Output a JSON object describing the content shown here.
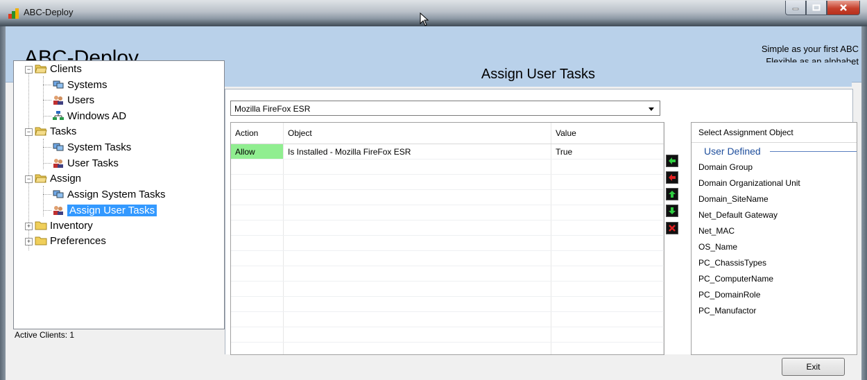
{
  "window": {
    "title": "ABC-Deploy"
  },
  "header": {
    "app_title": "ABC-Deploy",
    "tagline_line1": "Simple as your first ABC",
    "tagline_line2": "Flexible as an alphabet"
  },
  "tree": {
    "clients": "Clients",
    "systems": "Systems",
    "users": "Users",
    "windows_ad": "Windows AD",
    "tasks": "Tasks",
    "system_tasks": "System Tasks",
    "user_tasks": "User Tasks",
    "assign": "Assign",
    "assign_system_tasks": "Assign System Tasks",
    "assign_user_tasks": "Assign User Tasks",
    "inventory": "Inventory",
    "preferences": "Preferences"
  },
  "status": {
    "text": "Active Clients: 1"
  },
  "panel": {
    "title": "Assign User Tasks",
    "selected_task": "Mozilla FireFox ESR"
  },
  "grid": {
    "columns": {
      "action": "Action",
      "object": "Object",
      "value": "Value"
    },
    "rows": [
      {
        "action": "Allow",
        "object": "Is Installed - Mozilla FireFox ESR",
        "value": "True"
      }
    ]
  },
  "assign_list": {
    "header": "Select Assignment Object",
    "group": "User Defined",
    "items": [
      "Domain Group",
      "Domain Organizational Unit",
      "Domain_SiteName",
      "Net_Default Gateway",
      "Net_MAC",
      "OS_Name",
      "PC_ChassisTypes",
      "PC_ComputerName",
      "PC_DomainRole",
      "PC_Manufactor"
    ]
  },
  "buttons": {
    "exit": "Exit"
  }
}
